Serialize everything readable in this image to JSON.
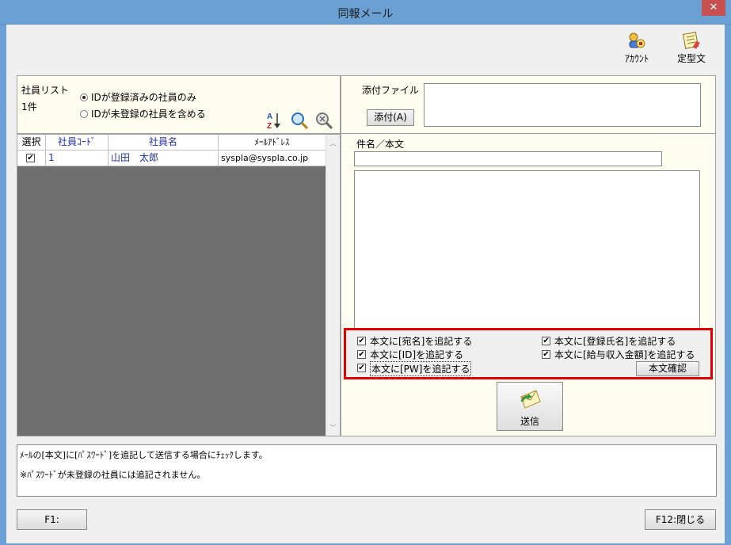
{
  "window": {
    "title": "同報メール",
    "close_label": "✕"
  },
  "toolbar": {
    "account_label": "ｱｶｳﾝﾄ",
    "template_label": "定型文"
  },
  "employee_list": {
    "title": "社員リスト",
    "count": "1件",
    "radio_registered": "IDが登録済みの社員のみ",
    "radio_unregistered": "IDが未登録の社員を含める",
    "columns": {
      "select": "選択",
      "code": "社員ｺｰﾄﾞ",
      "name": "社員名",
      "email": "ﾒｰﾙｱﾄﾞﾚｽ"
    },
    "rows": [
      {
        "selected": true,
        "code": "1",
        "name": "山田　太郎",
        "email": "syspla@syspla.co.jp"
      }
    ]
  },
  "attachment": {
    "label": "添付ファイル",
    "button": "添付(A)"
  },
  "message": {
    "label": "件名／本文",
    "subject": "",
    "body": ""
  },
  "options": {
    "opt1": "本文に[宛名]を追記する",
    "opt2": "本文に[ID]を追記する",
    "opt3": "本文に[PW]を追記する",
    "opt4": "本文に[登録氏名]を追記する",
    "opt5": "本文に[給与収入金額]を追記する",
    "confirm_button": "本文確認"
  },
  "send_button": "送信",
  "help": {
    "line1": "ﾒｰﾙの[本文]に[ﾊﾟｽﾜｰﾄﾞ]を追記して送信する場合にﾁｪｯｸします。",
    "line2": "※ﾊﾟｽﾜｰﾄﾞが未登録の社員には追記されません。"
  },
  "footer": {
    "f1": "F1:",
    "f12": "F12:閉じる"
  },
  "colors": {
    "titlebar": "#6aa0d3",
    "highlight": "#e00000",
    "grid_bg": "#6e6e6e",
    "panel_bg": "#fffdf0"
  }
}
